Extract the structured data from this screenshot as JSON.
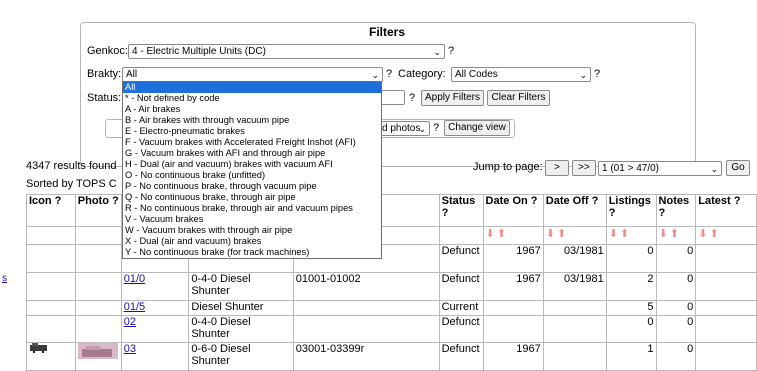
{
  "filters": {
    "title": "Filters",
    "genkoc_label": "Genkoc:",
    "genkoc_value": "4 - Electric Multiple Units (DC)",
    "brakty_label": "Brakty:",
    "brakty_value": "All",
    "category_label": "Category:",
    "category_value": "All Codes",
    "status_label": "Status:",
    "apply_label": "Apply Filters",
    "clear_label": "Clear Filters",
    "photos_value": "d photos",
    "change_view_label": "Change view",
    "help": "?"
  },
  "dropdown": {
    "options": [
      "All",
      "* - Not defined by code",
      "A - Air brakes",
      "B - Air brakes with through vacuum pipe",
      "E - Electro-pneumatic brakes",
      "F - Vacuum brakes with Accelerated Freight Inshot (AFI)",
      "G - Vacuum brakes with AFI and through air pipe",
      "H - Dual (air and vacuum) brakes with vacuum AFI",
      "O - No continuous brake (unfitted)",
      "P - No continuous brake, through vacuum pipe",
      "Q - No continuous brake, through air pipe",
      "R - No continuous brake, through air and vacuum pipes",
      "V - Vacuum brakes",
      "W - Vacuum brakes with through air pipe",
      "X - Dual (air and vacuum) brakes",
      "Y - No continuous brake (for track machines)"
    ]
  },
  "results": {
    "count_text": "4347 results found",
    "sorted_text": "Sorted by TOPS C",
    "jump_label": "Jump to page:",
    "next_label": ">",
    "last_label": ">>",
    "page_value": "1 (01 > 47/0)",
    "go_label": "Go",
    "side_link": "s"
  },
  "table": {
    "headers": {
      "icon": "Icon ?",
      "photo": "Photo ?",
      "status": "Status",
      "status_q": "?",
      "date_on": "Date On ?",
      "date_off": "Date Off ?",
      "listings": "Listings",
      "listings_q": "?",
      "notes": "Notes",
      "notes_q": "?",
      "latest": "Latest ?"
    },
    "sort_arrows": "⬇⬆",
    "rows": [
      {
        "code": "",
        "desc": "",
        "range": "",
        "status": "Defunct",
        "date_on": "1967",
        "date_off": "03/1981",
        "listings": "0",
        "notes": "0"
      },
      {
        "code": "01/0",
        "desc": "0-4-0 Diesel Shunter",
        "range": "01001-01002",
        "status": "Defunct",
        "date_on": "1967",
        "date_off": "03/1981",
        "listings": "2",
        "notes": "0"
      },
      {
        "code": "01/5",
        "desc": "Diesel Shunter",
        "range": "",
        "status": "Current",
        "date_on": "",
        "date_off": "",
        "listings": "5",
        "notes": "0"
      },
      {
        "code": "02",
        "desc": "0-4-0 Diesel Shunter",
        "range": "",
        "status": "Defunct",
        "date_on": "",
        "date_off": "",
        "listings": "0",
        "notes": "0"
      },
      {
        "code": "03",
        "desc": "0-6-0 Diesel Shunter",
        "range": "03001-03399r",
        "status": "Defunct",
        "date_on": "1967",
        "date_off": "",
        "listings": "1",
        "notes": "0"
      }
    ]
  },
  "colors": {
    "link": "#1a0dab",
    "highlight": "#1e6fd9",
    "sort_arrow": "#f48a8a"
  }
}
